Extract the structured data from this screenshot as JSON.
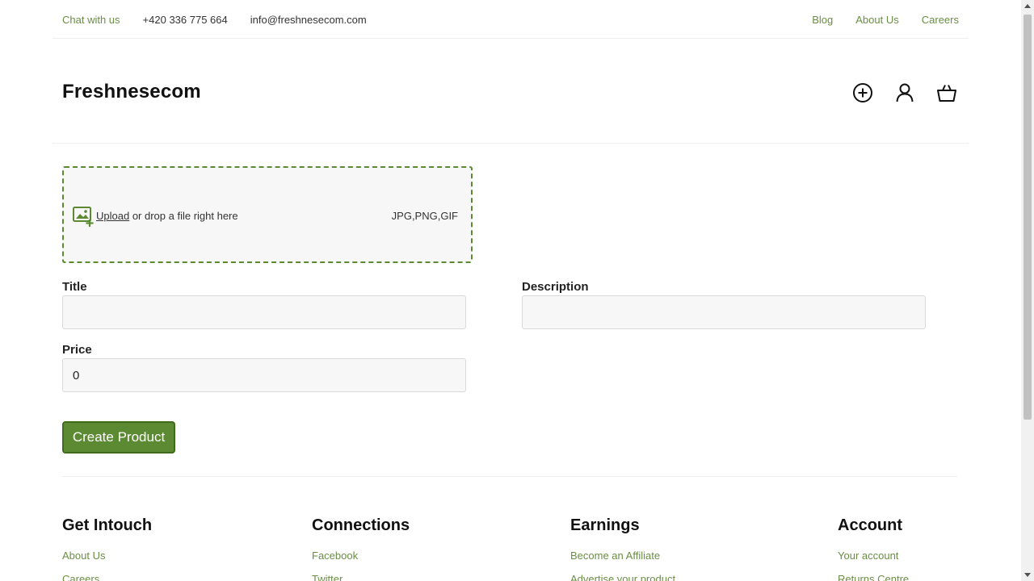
{
  "topbar": {
    "chat": "Chat with us",
    "phone": "+420 336 775 664",
    "email": "info@freshnesecom.com",
    "links": [
      "Blog",
      "About Us",
      "Careers"
    ]
  },
  "header": {
    "logo": "Freshnesecom",
    "icons": [
      "plus-circle-icon",
      "user-icon",
      "basket-icon"
    ]
  },
  "upload": {
    "link": "Upload",
    "text": " or drop a file right here",
    "formats": "JPG,PNG,GIF"
  },
  "form": {
    "title_label": "Title",
    "title_value": "",
    "description_label": "Description",
    "description_value": "",
    "price_label": "Price",
    "price_value": "0",
    "submit_label": "Create Product"
  },
  "footer": {
    "columns": [
      {
        "heading": "Get Intouch",
        "links": [
          "About Us",
          "Careers"
        ]
      },
      {
        "heading": "Connections",
        "links": [
          "Facebook",
          "Twitter"
        ]
      },
      {
        "heading": "Earnings",
        "links": [
          "Become an Affiliate",
          "Advertise your product"
        ]
      },
      {
        "heading": "Account",
        "links": [
          "Your account",
          "Returns Centre"
        ]
      }
    ]
  },
  "colors": {
    "accent": "#5b8a32",
    "link": "#6a8e45"
  }
}
